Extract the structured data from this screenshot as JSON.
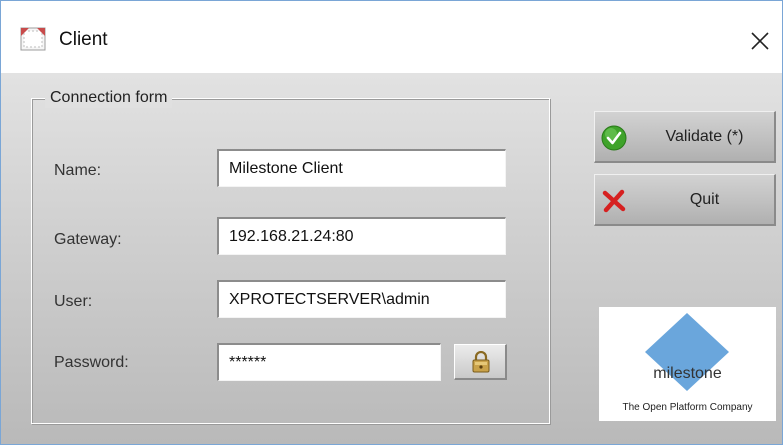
{
  "window": {
    "title": "Client",
    "close_glyph": "✕"
  },
  "form": {
    "legend": "Connection form",
    "fields": [
      {
        "label": "Name:",
        "value": "Milestone Client"
      },
      {
        "label": "Gateway:",
        "value": "192.168.21.24:80"
      },
      {
        "label": "User:",
        "value": "XPROTECTSERVER\\admin"
      },
      {
        "label": "Password:",
        "value": "******"
      }
    ],
    "lock_icon": "lock-icon"
  },
  "buttons": {
    "validate_label": "Validate (*)",
    "validate_icon": "checkmark-icon",
    "quit_label": "Quit",
    "quit_icon": "red-x-icon"
  },
  "logo": {
    "wordmark": "milestone",
    "tagline": "The Open Platform Company"
  },
  "colors": {
    "validate_green": "#3fa32a",
    "quit_red": "#d62020",
    "logo_blue": "#6aa6dc",
    "lock_gold": "#c9a24a"
  }
}
